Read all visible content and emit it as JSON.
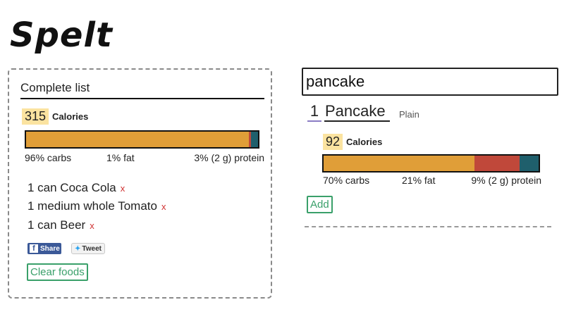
{
  "app": {
    "logo": "Spelt"
  },
  "complete_list": {
    "title": "Complete list",
    "calories_value": "315",
    "calories_label": "Calories",
    "macros": {
      "carbs_pct": 96,
      "fat_pct": 1,
      "protein_pct": 3
    },
    "carbs_label": "96% carbs",
    "fat_label": "1% fat",
    "protein_label": "3% (2 g) protein",
    "items": [
      {
        "label": "1 can Coca Cola",
        "remove": "x"
      },
      {
        "label": "1 medium whole Tomato",
        "remove": "x"
      },
      {
        "label": "1 can Beer",
        "remove": "x"
      }
    ],
    "share_label": "Share",
    "tweet_label": "Tweet",
    "clear_label": "Clear foods"
  },
  "search": {
    "value": "pancake"
  },
  "result": {
    "quantity": "1",
    "name": "Pancake",
    "variant": "Plain",
    "calories_value": "92",
    "calories_label": "Calories",
    "macros": {
      "carbs_pct": 70,
      "fat_pct": 21,
      "protein_pct": 9
    },
    "carbs_label": "70% carbs",
    "fat_label": "21% fat",
    "protein_label": "9% (2 g) protein",
    "add_label": "Add"
  },
  "colors": {
    "carbs": "#e09e38",
    "fat": "#c0483a",
    "protein": "#1f5f6c",
    "accent": "#3aa06a",
    "calorie_highlight": "#fbe3a0"
  }
}
